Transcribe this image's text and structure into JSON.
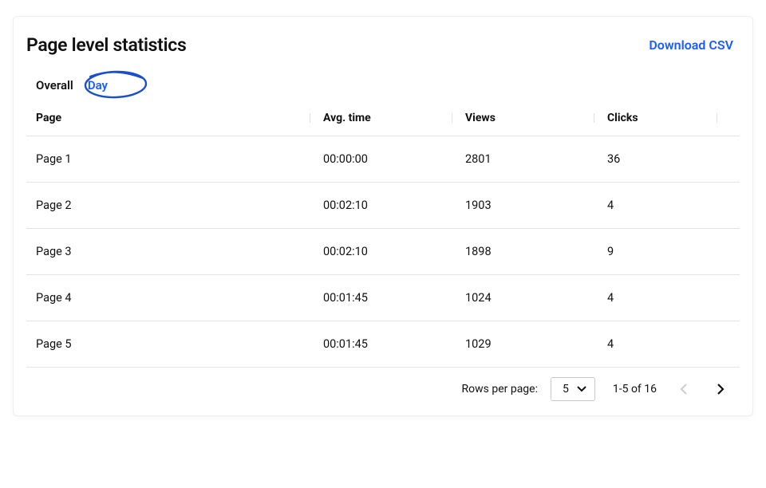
{
  "header": {
    "title": "Page level statistics",
    "download_label": "Download CSV"
  },
  "tabs": {
    "items": [
      {
        "label": "Overall",
        "active": false
      },
      {
        "label": "Day",
        "active": true
      }
    ]
  },
  "table": {
    "columns": [
      {
        "label": "Page"
      },
      {
        "label": "Avg. time"
      },
      {
        "label": "Views"
      },
      {
        "label": "Clicks"
      }
    ],
    "rows": [
      {
        "page": "Page 1",
        "avg_time": "00:00:00",
        "views": "2801",
        "clicks": "36"
      },
      {
        "page": "Page 2",
        "avg_time": "00:02:10",
        "views": "1903",
        "clicks": "4"
      },
      {
        "page": "Page 3",
        "avg_time": "00:02:10",
        "views": "1898",
        "clicks": "9"
      },
      {
        "page": "Page 4",
        "avg_time": "00:01:45",
        "views": "1024",
        "clicks": "4"
      },
      {
        "page": "Page 5",
        "avg_time": "00:01:45",
        "views": "1029",
        "clicks": "4"
      }
    ]
  },
  "pagination": {
    "rows_per_page_label": "Rows per page:",
    "rows_per_page_value": "5",
    "range_label": "1-5 of 16",
    "prev_enabled": false,
    "next_enabled": true
  },
  "colors": {
    "accent": "#1a5cff",
    "annotation_stroke": "#1a4fc8"
  }
}
